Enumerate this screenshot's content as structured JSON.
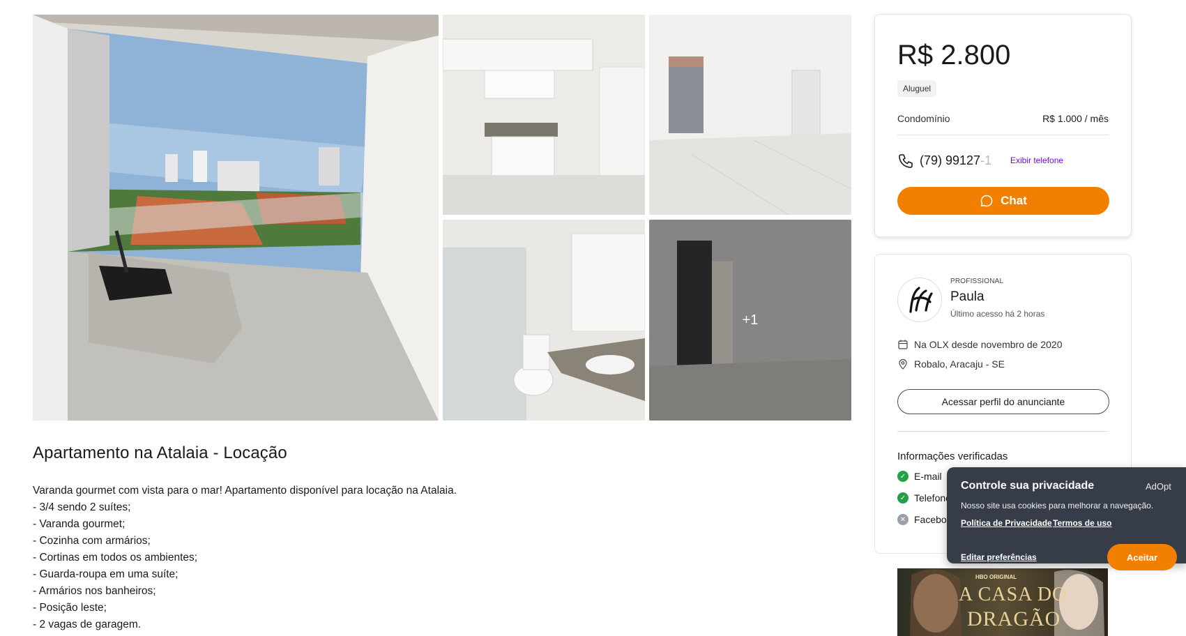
{
  "gallery": {
    "more_count": "+1"
  },
  "ad": {
    "title": "Apartamento na Atalaia - Locação",
    "description_lines": [
      "Varanda gourmet com vista para o mar! Apartamento disponível para locação na Atalaia.",
      "- 3/4 sendo 2 suítes;",
      "- Varanda gourmet;",
      "- Cozinha com armários;",
      "- Cortinas em todos os ambientes;",
      "- Guarda-roupa em uma suíte;",
      "- Armários nos banheiros;",
      "- Posição leste;",
      "- 2 vagas de garagem."
    ]
  },
  "price_card": {
    "price": "R$ 2.800",
    "type_tag": "Aluguel",
    "condo_label": "Condomínio",
    "condo_value": "R$ 1.000 / mês",
    "phone_visible": "(79) 99127",
    "phone_faded": "-1",
    "show_phone_label": "Exibir telefone",
    "chat_label": "Chat",
    "accent_color": "#f28000",
    "link_color": "#6e0ad6"
  },
  "seller": {
    "badge": "PROFISSIONAL",
    "name": "Paula",
    "last_seen": "Último acesso há 2 horas",
    "since": "Na OLX desde novembro de 2020",
    "location": "Robalo, Aracaju - SE",
    "profile_button": "Acessar perfil do anunciante",
    "verified_title": "Informações verificadas",
    "verified_items": [
      {
        "label": "E-mail",
        "status": "verified"
      },
      {
        "label": "Telefone",
        "status": "verified"
      },
      {
        "label": "Facebook",
        "status": "not-verified"
      }
    ]
  },
  "banner": {
    "brand": "HBO ORIGINAL",
    "title_line1": "A CASA DO",
    "title_line2": "DRAGÃO"
  },
  "privacy": {
    "title": "Controle sua privacidade",
    "brand": "AdOpt",
    "text": "Nosso site usa cookies para melhorar a navegação.",
    "policy_link": "Política de Privacidade",
    "terms_link": "Termos de uso",
    "edit_label": "Editar preferências",
    "accept_label": "Aceitar"
  }
}
